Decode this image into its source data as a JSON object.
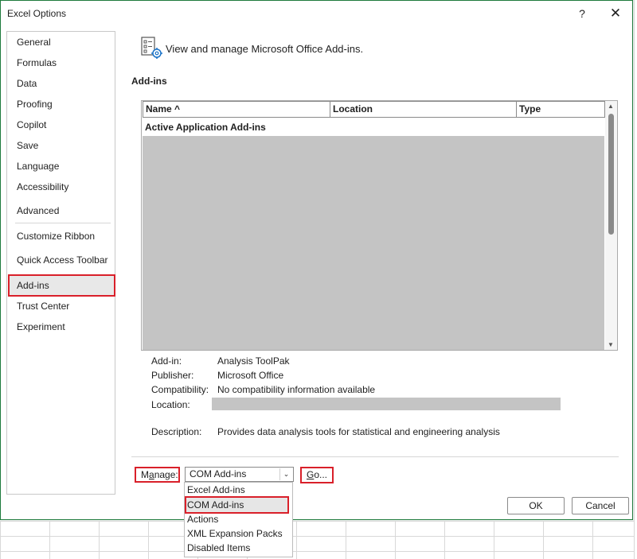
{
  "window": {
    "title": "Excel Options",
    "help_glyph": "?",
    "close_glyph": "✕"
  },
  "sidebar": {
    "items": [
      {
        "label": "General"
      },
      {
        "label": "Formulas"
      },
      {
        "label": "Data"
      },
      {
        "label": "Proofing"
      },
      {
        "label": "Copilot"
      },
      {
        "label": "Save"
      },
      {
        "label": "Language"
      },
      {
        "label": "Accessibility"
      },
      {
        "label": "Advanced"
      },
      {
        "label": "Customize Ribbon"
      },
      {
        "label": "Quick Access Toolbar"
      },
      {
        "label": "Add-ins"
      },
      {
        "label": "Trust Center"
      },
      {
        "label": "Experiment"
      }
    ],
    "selected": "Add-ins"
  },
  "header": {
    "text": "View and manage Microsoft Office Add-ins.",
    "icon": "addins-gear-icon"
  },
  "section": {
    "title": "Add-ins"
  },
  "table": {
    "columns": [
      "Name ^",
      "Location",
      "Type"
    ],
    "group_label": "Active Application Add-ins"
  },
  "details": {
    "addin_label": "Add-in:",
    "addin_value": "Analysis ToolPak",
    "publisher_label": "Publisher:",
    "publisher_value": "Microsoft Office",
    "compat_label": "Compatibility:",
    "compat_value": "No compatibility information available",
    "location_label": "Location:",
    "description_label": "Description:",
    "description_value": "Provides data analysis tools for statistical and engineering analysis"
  },
  "manage": {
    "label_prefix": "M",
    "label_underlined": "a",
    "label_rest": "nage:",
    "selected": "COM Add-ins",
    "go_underlined": "G",
    "go_rest": "o...",
    "options": [
      "Excel Add-ins",
      "COM Add-ins",
      "Actions",
      "XML Expansion Packs",
      "Disabled Items"
    ]
  },
  "buttons": {
    "ok": "OK",
    "cancel": "Cancel"
  },
  "colors": {
    "highlight": "#d9202a",
    "window_border": "#1e7a3c",
    "redacted": "#c4c4c4"
  }
}
